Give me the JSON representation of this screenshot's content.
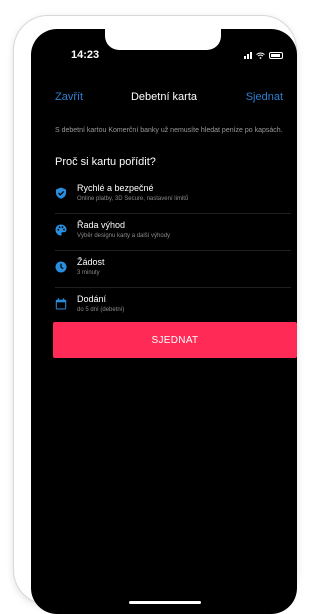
{
  "status": {
    "time": "14:23"
  },
  "nav": {
    "left": "Zavřít",
    "title": "Debetní karta",
    "right": "Sjednat"
  },
  "intro": "S debetní kartou Komerční banky už nemusíte hledat peníze po kapsách.",
  "section_title": "Proč si kartu pořídit?",
  "features": [
    {
      "icon": "shield-check-icon",
      "title": "Rychlé a bezpečné",
      "subtitle": "Online platby, 3D Secure, nastavení limitů"
    },
    {
      "icon": "palette-icon",
      "title": "Řada výhod",
      "subtitle": "Výběr designu karty a další výhody"
    },
    {
      "icon": "clock-icon",
      "title": "Žádost",
      "subtitle": "3 minuty"
    },
    {
      "icon": "calendar-icon",
      "title": "Dodání",
      "subtitle": "do 5 dní (debetní)"
    }
  ],
  "cta_label": "SJEDNAT",
  "colors": {
    "accent_link": "#2d7fd0",
    "icon": "#2a8dde",
    "cta": "#ff2b56"
  }
}
